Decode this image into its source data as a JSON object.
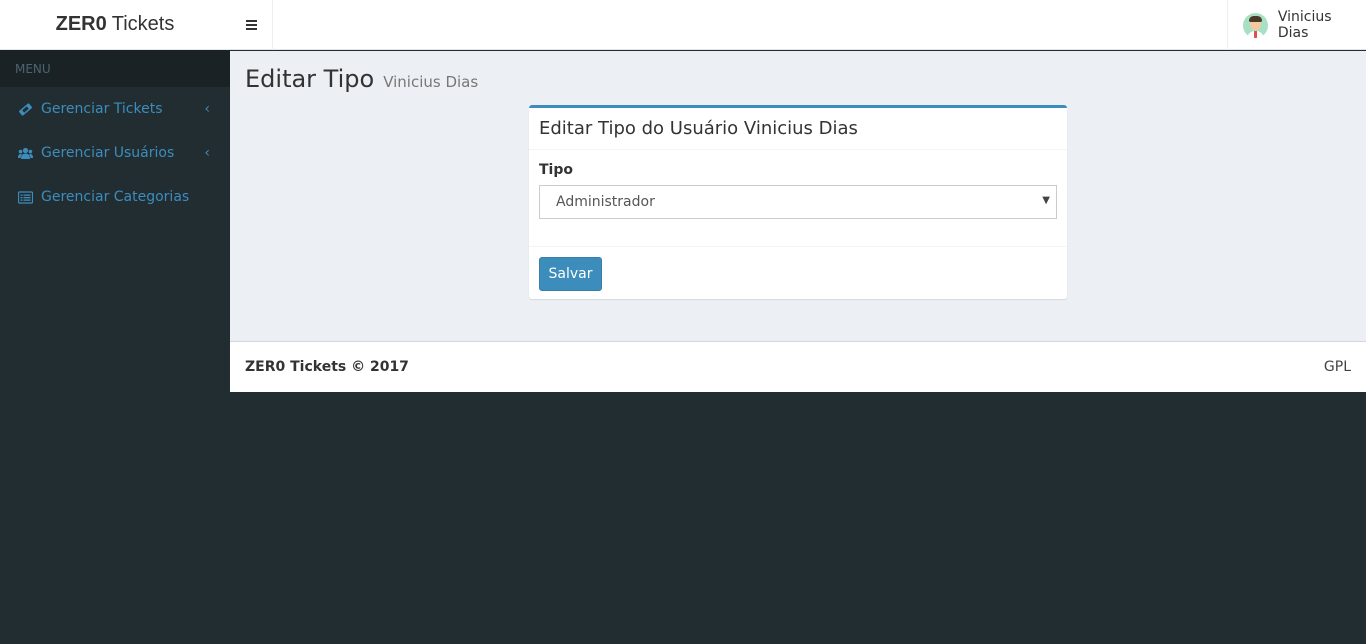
{
  "app": {
    "logo_bold": "ZER0",
    "logo_text": "Tickets"
  },
  "navbar": {
    "user_name": "Vinicius Dias"
  },
  "sidebar": {
    "header": "MENU",
    "items": [
      {
        "label": "Gerenciar Tickets",
        "icon": "ticket-icon",
        "has_submenu": true
      },
      {
        "label": "Gerenciar Usuários",
        "icon": "users-icon",
        "has_submenu": true
      },
      {
        "label": "Gerenciar Categorias",
        "icon": "list-alt-icon",
        "has_submenu": false
      }
    ]
  },
  "page": {
    "title": "Editar Tipo",
    "subtitle": "Vinicius Dias"
  },
  "form": {
    "box_title": "Editar Tipo do Usuário Vinicius Dias",
    "field_label": "Tipo",
    "selected_value": "Administrador",
    "submit_label": "Salvar"
  },
  "footer": {
    "copyright": "ZER0 Tickets © 2017",
    "license": "GPL"
  },
  "colors": {
    "accent": "#3c8dbc",
    "sidebar_bg": "#222d32",
    "content_bg": "#ecf0f5"
  }
}
